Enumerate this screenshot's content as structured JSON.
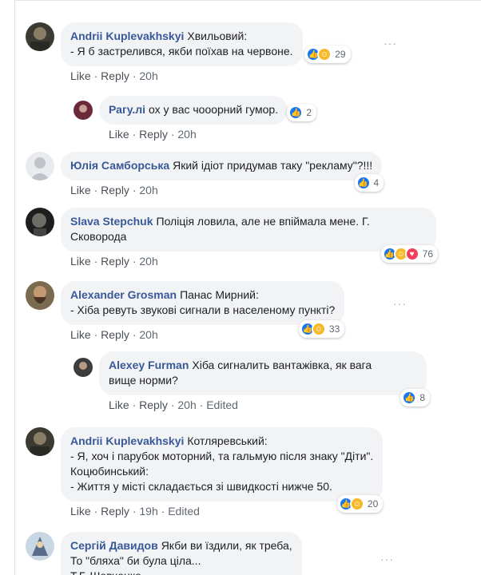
{
  "comments": [
    {
      "author": "Andrii Kuplevakhskyi",
      "text": "Хвильовий:\n- Я б застрелився, якби поїхав на червоне.",
      "reactions": "29",
      "like": "Like",
      "reply": "Reply",
      "time": "20h",
      "edited": ""
    },
    {
      "author": "Рагу.лі",
      "text": "ох у вас чооорний гумор.",
      "reactions": "2",
      "like": "Like",
      "reply": "Reply",
      "time": "20h",
      "edited": ""
    },
    {
      "author": "Юлія Самборська",
      "text": "Який ідіот придумав таку \"рекламу\"?!!!",
      "reactions": "4",
      "like": "Like",
      "reply": "Reply",
      "time": "20h",
      "edited": ""
    },
    {
      "author": "Slava Stepchuk",
      "text": "Поліція ловила, але не впіймала мене. Г.\nСковорода",
      "reactions": "76",
      "like": "Like",
      "reply": "Reply",
      "time": "20h",
      "edited": ""
    },
    {
      "author": "Alexander Grosman",
      "text": "Панас Мирний:\n- Хіба ревуть звукові сигнали в населеному пункті?",
      "reactions": "33",
      "like": "Like",
      "reply": "Reply",
      "time": "20h",
      "edited": ""
    },
    {
      "author": "Alexey Furman",
      "text": "Хіба сигналить вантажівка, як вага\nвище норми?",
      "reactions": "8",
      "like": "Like",
      "reply": "Reply",
      "time": "20h",
      "edited": "Edited"
    },
    {
      "author": "Andrii Kuplevakhskyi",
      "text": "Котляревський:\n- Я, хоч і парубок моторний, та гальмую після знаку \"Діти\".\nКоцюбинський:\n- Життя у місті складається зі швидкості нижче 50.",
      "reactions": "20",
      "like": "Like",
      "reply": "Reply",
      "time": "19h",
      "edited": "Edited"
    },
    {
      "author": "Сергій Давидов",
      "text": "Якби ви їздили, як треба,\nТо \"бляха\" би була ціла...\nТ.Г. Шевченко",
      "reactions": "",
      "like": "",
      "reply": "",
      "time": "",
      "edited": ""
    }
  ],
  "sep": " · ",
  "more": "···"
}
